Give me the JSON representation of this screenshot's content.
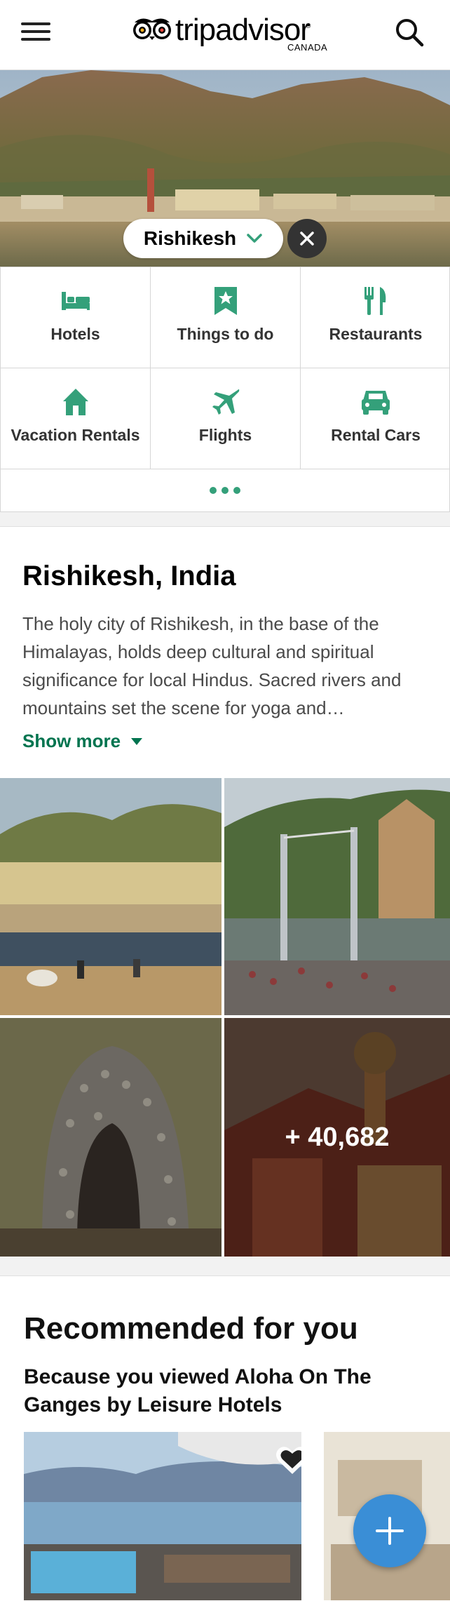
{
  "header": {
    "logo_text": "tripadvisor",
    "logo_reg": "®",
    "logo_country": "CANADA",
    "menu_icon": "hamburger-menu-icon",
    "search_icon": "search-icon"
  },
  "hero": {
    "location": "Rishikesh",
    "dropdown_icon": "chevron-down-icon",
    "clear_icon": "close-icon"
  },
  "categories": [
    {
      "label": "Hotels",
      "icon": "bed-icon"
    },
    {
      "label": "Things to do",
      "icon": "bookmark-star-icon"
    },
    {
      "label": "Restaurants",
      "icon": "fork-knife-icon"
    },
    {
      "label": "Vacation Rentals",
      "icon": "house-icon"
    },
    {
      "label": "Flights",
      "icon": "airplane-icon"
    },
    {
      "label": "Rental Cars",
      "icon": "car-icon"
    }
  ],
  "more_icon": "more-dots-icon",
  "intro": {
    "title": "Rishikesh, India",
    "description": "The holy city of Rishikesh, in the base of the Himalayas, holds deep cultural and spiritual significance for local Hindus. Sacred rivers and mountains set the scene for yoga and…",
    "show_more": "Show more",
    "photo_count": "+ 40,682"
  },
  "recommended": {
    "title": "Recommended for you",
    "subtitle": "Because you viewed Aloha On The Ganges by Leisure Hotels",
    "heart_icon": "heart-icon"
  },
  "fab_icon": "plus-icon",
  "colors": {
    "accent_green": "#34a07a",
    "link_green": "#00744f",
    "fab_blue": "#3a8ed6"
  }
}
